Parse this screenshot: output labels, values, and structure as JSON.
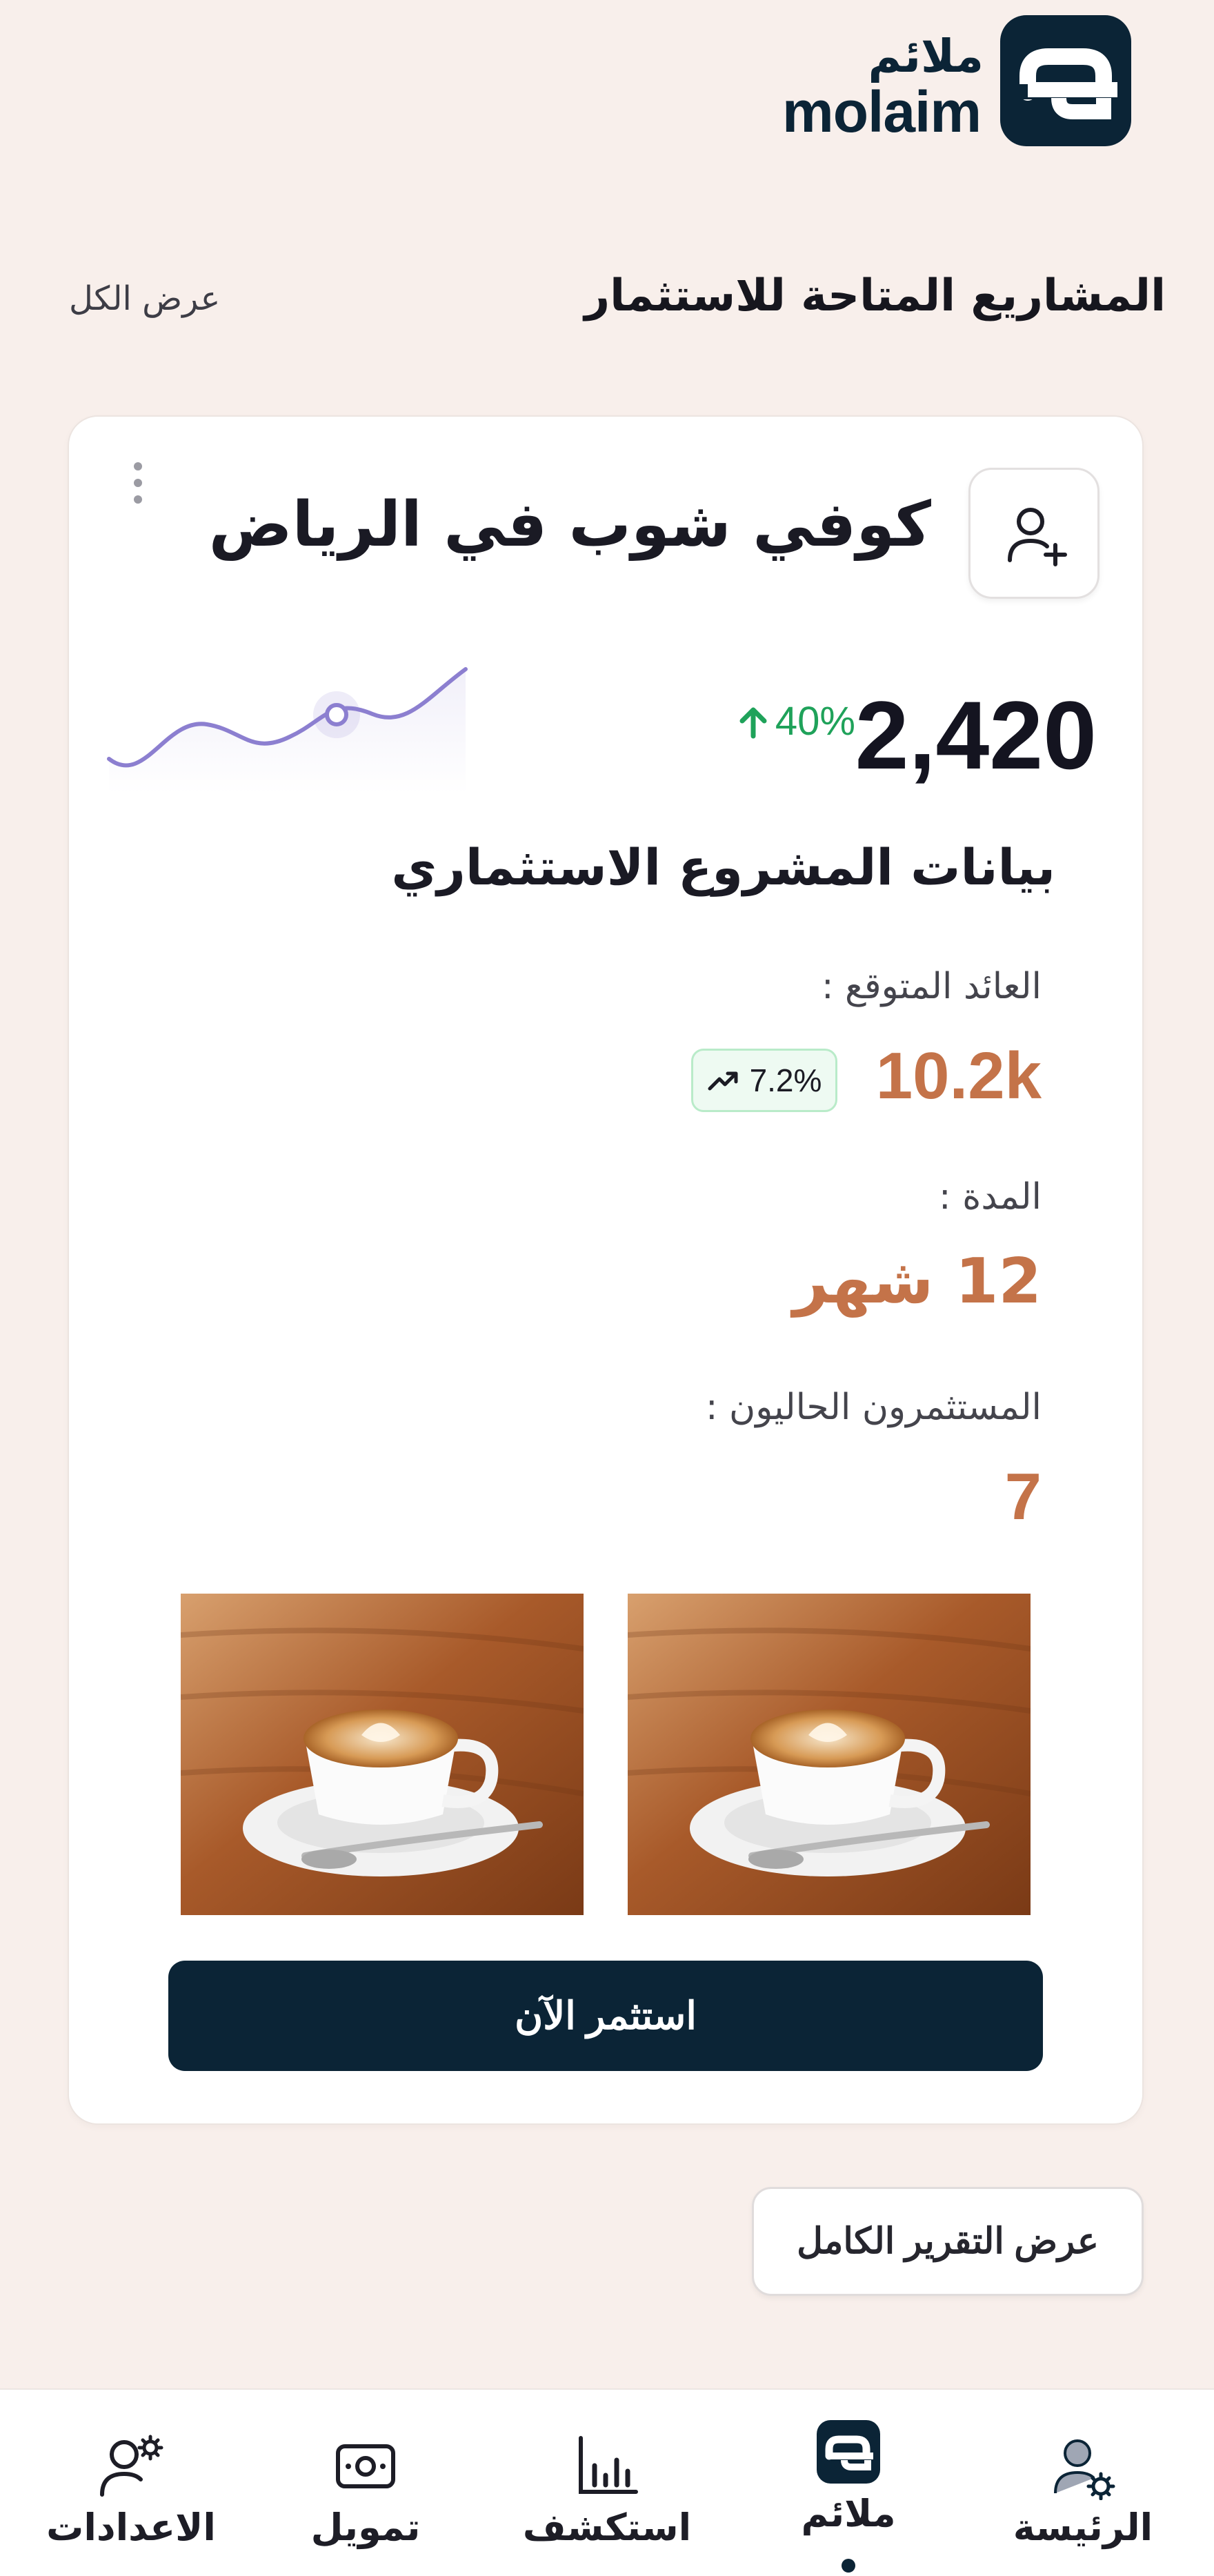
{
  "brand": {
    "name_ar": "ملائم",
    "name_en": "molaim",
    "color": "#0b2436"
  },
  "section": {
    "title": "المشاريع المتاحة للاستثمار",
    "view_all": "عرض الكل"
  },
  "project": {
    "title": "كوفي شوب في الرياض",
    "stat_value": "2,420",
    "stat_change": "40%",
    "stat_trend": "up",
    "data_title": "بيانات المشروع الاستثماري",
    "expected_return_label": "العائد المتوقع :",
    "expected_return_value": "10.2k",
    "return_badge": "7.2%",
    "duration_label": "المدة :",
    "duration_value": "12 شهر",
    "investors_label": "المستثمرون الحاليون :",
    "investors_value": "7",
    "invest_button": "استثمر الآن"
  },
  "report_button": "عرض التقرير الكامل",
  "nav": {
    "items": [
      {
        "label": "الرئيسة",
        "icon": "user-gear-icon"
      },
      {
        "label": "ملائم",
        "icon": "molaim-logo-icon",
        "active": true
      },
      {
        "label": "استكشف",
        "icon": "bar-chart-icon"
      },
      {
        "label": "تمويل",
        "icon": "money-icon"
      },
      {
        "label": "الاعدادات",
        "icon": "user-settings-icon"
      }
    ]
  },
  "colors": {
    "accent": "#c47349",
    "positive": "#1fa25a",
    "chart_line": "#8c7fd0",
    "background": "#f8efeb"
  }
}
